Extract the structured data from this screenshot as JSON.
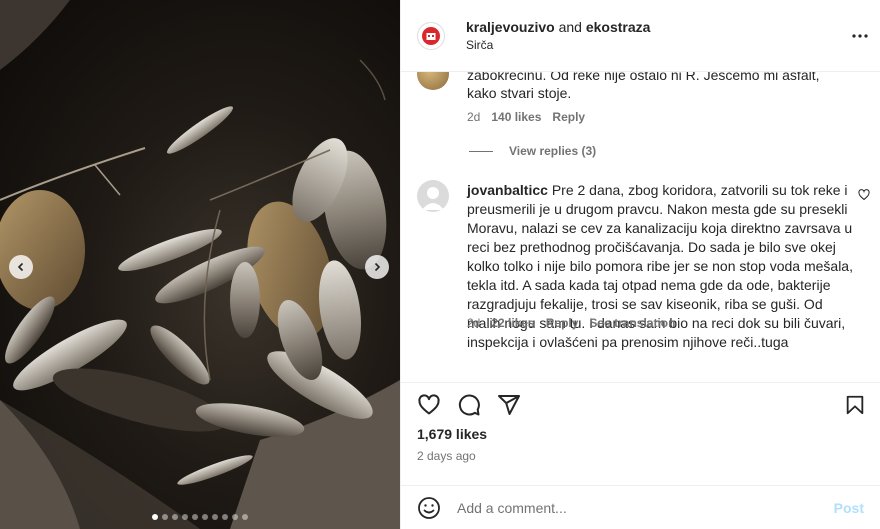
{
  "carousel": {
    "prev_icon": "chevron-left-icon",
    "next_icon": "chevron-right-icon",
    "dot_count": 10,
    "active_dot": 0
  },
  "header": {
    "user1": "kraljevouzivo",
    "and_text": "and",
    "user2": "ekostraza",
    "location": "Sirča"
  },
  "comments": [
    {
      "text": "zabokrecinu. Od reke nije ostalo ni R. Ješćemo mi asfalt, kako stvari stoje.",
      "age": "2d",
      "likes": "140 likes",
      "reply": "Reply",
      "view_replies": "View replies (3)"
    },
    {
      "username": "jovanbalticc",
      "text": "Pre 2 dana, zbog koridora, zatvorili su tok reke i preusmerili je u drugom pravcu. Nakon mesta gde su presekli Moravu, nalazi se cev za kanalizaciju koja direktno zavrsava u reci bez prethodnog pročišćavanja. Do sada je bilo sve okej kolko tolko i nije bilo pomora ribe jer se non stop voda mešala, tekla itd. A sada kada taj otpad nema gde da ode, bakterije razgradjuju fekalije, trosi se sav kiseonik, riba se guši. Od malih nogu sam tu. I danas sam bio na reci dok su bili čuvari, inspekcija i ovlašćeni pa prenosim njihove reči..tuga",
      "age": "2d",
      "likes": "22 likes",
      "reply": "Reply",
      "translate": "See translation"
    }
  ],
  "post": {
    "likes": "1,679 likes",
    "ago": "2 days ago"
  },
  "composer": {
    "placeholder": "Add a comment...",
    "post_label": "Post"
  },
  "colors": {
    "brand_red": "#d9272e",
    "link_blue_disabled": "#b2dffc",
    "meta_gray": "#737373"
  }
}
